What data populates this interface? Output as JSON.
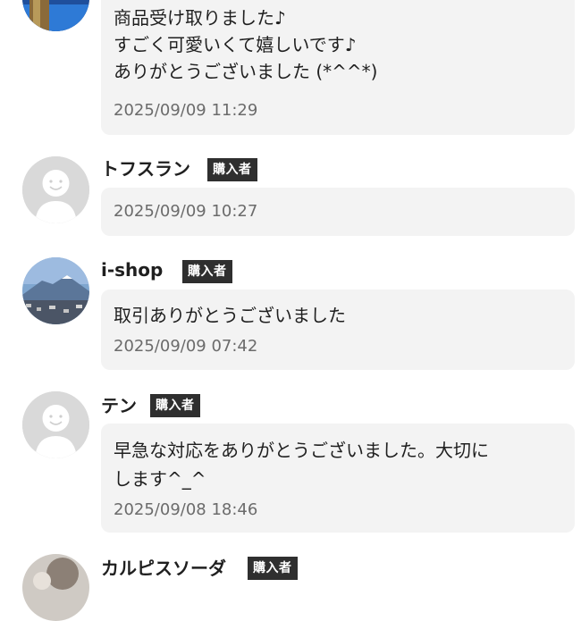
{
  "comments": [
    {
      "lines": [
        "商品受け取りました♪",
        "すごく可愛いくて嬉しいです♪",
        "ありがとうございました (*^^*)"
      ],
      "timestamp": "2025/09/09 11:29"
    },
    {
      "name": "トフスラン",
      "badge": "購入者",
      "lines": [],
      "timestamp": "2025/09/09 10:27"
    },
    {
      "name": "i-shop",
      "badge": "購入者",
      "lines": [
        "取引ありがとうございました"
      ],
      "timestamp": "2025/09/09 07:42"
    },
    {
      "name": "テン",
      "badge": "購入者",
      "lines": [
        "早急な対応をありがとうございました。大切に",
        "します^_^"
      ],
      "timestamp": "2025/09/08 18:46"
    },
    {
      "name": "カルピスソーダ",
      "badge": "購入者"
    }
  ],
  "colors": {
    "bubble": "#f3f3f3",
    "badge_bg": "#2f2f2f",
    "timestamp": "#6b6b6b",
    "default_avatar_bg": "#d9d9d9"
  },
  "icons": [
    "user-photo-avatar",
    "default-person-avatar",
    "landscape-photo-avatar",
    "default-person-avatar",
    "user-photo-avatar"
  ]
}
